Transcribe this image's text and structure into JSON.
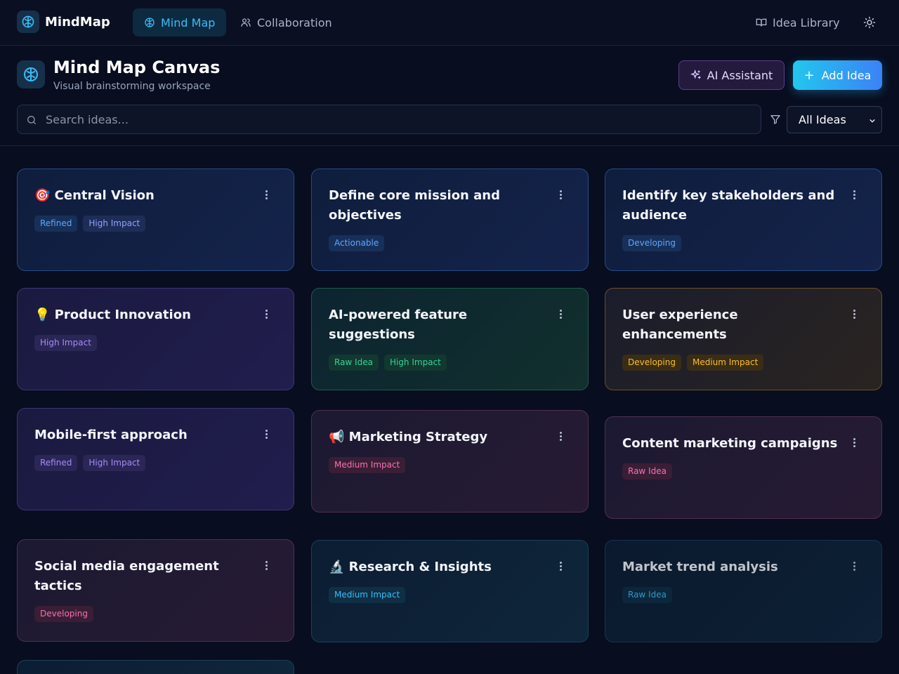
{
  "nav": {
    "brand": "MindMap",
    "tabs": [
      {
        "label": "Mind Map"
      },
      {
        "label": "Collaboration"
      }
    ],
    "library": "Idea Library"
  },
  "header": {
    "title": "Mind Map Canvas",
    "subtitle": "Visual brainstorming workspace",
    "ai_button": "AI Assistant",
    "add_button": "Add Idea"
  },
  "search": {
    "placeholder": "Search ideas...",
    "filter_value": "All Ideas"
  },
  "cards": [
    {
      "title": "🎯 Central Vision",
      "tags": [
        "Refined",
        "High Impact"
      ]
    },
    {
      "title": "Define core mission and objectives",
      "tags": [
        "Actionable"
      ]
    },
    {
      "title": "Identify key stakeholders and audience",
      "tags": [
        "Developing"
      ]
    },
    {
      "title": "💡 Product Innovation",
      "tags": [
        "High Impact"
      ]
    },
    {
      "title": "AI-powered feature suggestions",
      "tags": [
        "Raw Idea",
        "High Impact"
      ]
    },
    {
      "title": "User experience enhancements",
      "tags": [
        "Developing",
        "Medium Impact"
      ]
    },
    {
      "title": "Mobile-first approach",
      "tags": [
        "Refined",
        "High Impact"
      ]
    },
    {
      "title": "📢 Marketing Strategy",
      "tags": [
        "Medium Impact"
      ]
    },
    {
      "title": "Content marketing campaigns",
      "tags": [
        "Raw Idea"
      ]
    },
    {
      "title": "Social media engagement tactics",
      "tags": [
        "Developing"
      ]
    },
    {
      "title": "🔬 Research & Insights",
      "tags": [
        "Medium Impact"
      ]
    },
    {
      "title": "Market trend analysis",
      "tags": [
        "Raw Idea"
      ]
    }
  ],
  "colors": {
    "accent": "#38bdf8",
    "background": "#080d1f",
    "add_gradient_start": "#22c7ee",
    "add_gradient_end": "#3b82f6"
  }
}
